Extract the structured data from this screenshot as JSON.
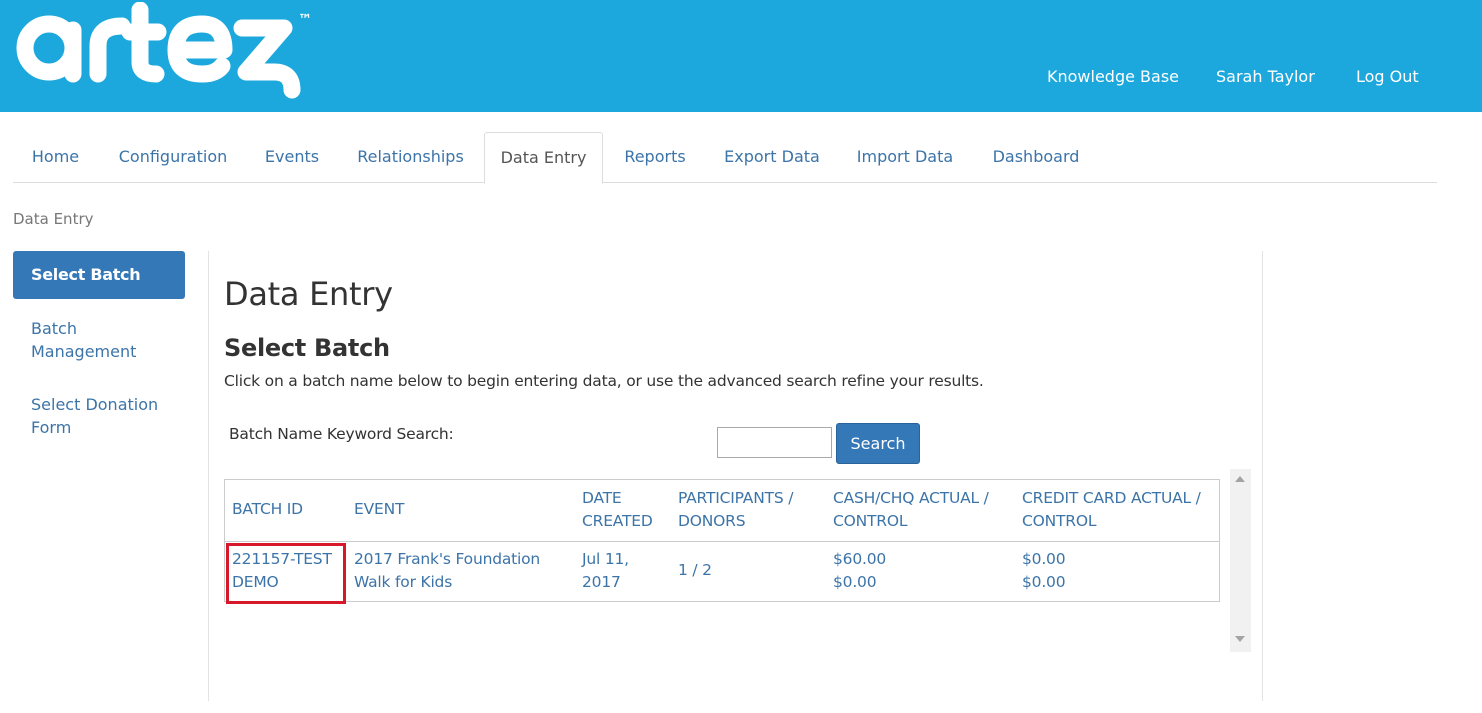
{
  "header": {
    "logo_text": "artez",
    "links": [
      "Knowledge Base",
      "Sarah Taylor",
      "Log Out"
    ],
    "brand_color": "#1ca8dd"
  },
  "tabs": [
    "Home",
    "Configuration",
    "Events",
    "Relationships",
    "Data Entry",
    "Reports",
    "Export Data",
    "Import Data",
    "Dashboard"
  ],
  "active_tab": "Data Entry",
  "breadcrumb": "Data Entry",
  "sidebar": {
    "active_item": "Select Batch",
    "items": [
      {
        "line1": "Batch",
        "line2": "Management"
      },
      {
        "line1": "Select Donation",
        "line2": "Form"
      }
    ]
  },
  "main": {
    "title": "Data Entry",
    "section_title": "Select Batch",
    "instructions": "Click on a batch name below to begin entering data, or use the advanced search refine your results.",
    "search_label": "Batch Name Keyword Search:",
    "search_value": "",
    "search_button": "Search"
  },
  "table": {
    "headers": [
      {
        "l1": "BATCH ID",
        "l2": ""
      },
      {
        "l1": "EVENT",
        "l2": ""
      },
      {
        "l1": "DATE",
        "l2": "CREATED"
      },
      {
        "l1": "PARTICIPANTS /",
        "l2": "DONORS"
      },
      {
        "l1": "CASH/CHQ ACTUAL /",
        "l2": "CONTROL"
      },
      {
        "l1": "CREDIT CARD ACTUAL /",
        "l2": "CONTROL"
      }
    ],
    "rows": [
      {
        "batch_id_l1": "221157-TEST",
        "batch_id_l2": "DEMO",
        "event_l1": "2017 Frank's Foundation",
        "event_l2": "Walk for Kids",
        "date_l1": "Jul 11,",
        "date_l2": "2017",
        "participants": "1 / 2",
        "cash_actual": "$60.00",
        "cash_control": "$0.00",
        "cc_actual": "$0.00",
        "cc_control": "$0.00"
      }
    ]
  },
  "highlight_color": "#d7182a"
}
